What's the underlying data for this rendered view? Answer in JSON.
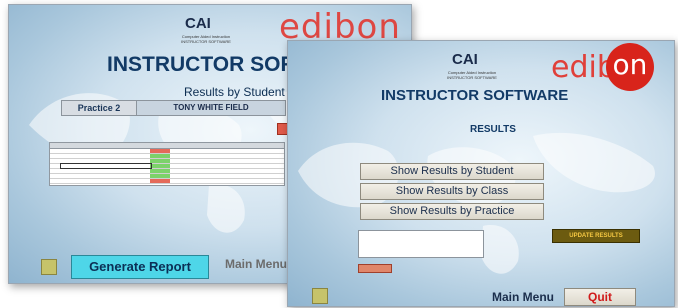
{
  "back_window": {
    "cai": "CAI",
    "cai_subtitle": "Computer Aided Instruction",
    "cai_subtitle2": "INSTRUCTOR SOFTWARE",
    "brand": "edibon",
    "title": "INSTRUCTOR SOFTWARE",
    "heading": "Results by Student",
    "practice_tab": "Practice 2",
    "student_name": "TONY WHITE FIELD",
    "generate_report": "Generate Report",
    "main_menu": "Main Menu"
  },
  "front_window": {
    "cai": "CAI",
    "cai_subtitle": "Computer Aided Instruction",
    "cai_subtitle2": "INSTRUCTOR SOFTWARE",
    "brand": "edib",
    "brand_on": "on",
    "title": "INSTRUCTOR SOFTWARE",
    "heading": "RESULTS",
    "show_by_student": "Show Results by Student",
    "show_by_class": "Show Results by Class",
    "show_by_practice": "Show Results by Practice",
    "update_results": "UPDATE RESULTS",
    "main_menu": "Main Menu",
    "quit": "Quit"
  },
  "colors": {
    "brand_red": "#d8241b",
    "generate_report_bg": "#4ed6e8",
    "update_bg": "#6c5b10",
    "update_text": "#f5c842"
  }
}
